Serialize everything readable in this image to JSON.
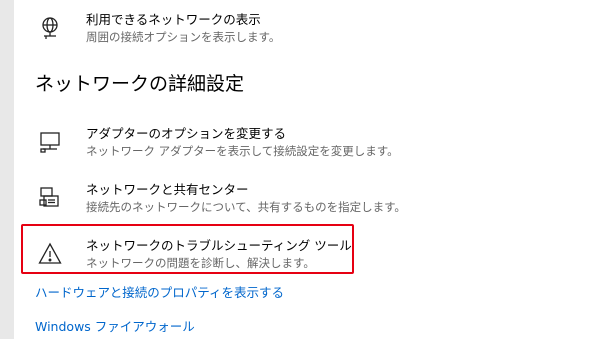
{
  "options": {
    "available_networks": {
      "title": "利用できるネットワークの表示",
      "description": "周囲の接続オプションを表示します。",
      "icon": "network-globe-icon"
    }
  },
  "advanced_section": {
    "heading": "ネットワークの詳細設定",
    "items": [
      {
        "title": "アダプターのオプションを変更する",
        "description": "ネットワーク アダプターを表示して接続設定を変更します。",
        "icon": "adapter-monitor-icon"
      },
      {
        "title": "ネットワークと共有センター",
        "description": "接続先のネットワークについて、共有するものを指定します。",
        "icon": "sharing-center-icon"
      },
      {
        "title": "ネットワークのトラブルシューティング ツール",
        "description": "ネットワークの問題を診断し、解決します。",
        "icon": "warning-triangle-icon"
      }
    ]
  },
  "links": {
    "hardware_properties": "ハードウェアと接続のプロパティを表示する",
    "firewall": "Windows ファイアウォール"
  },
  "colors": {
    "link": "#0066cc",
    "highlight": "#e60012",
    "description_text": "#666666"
  }
}
